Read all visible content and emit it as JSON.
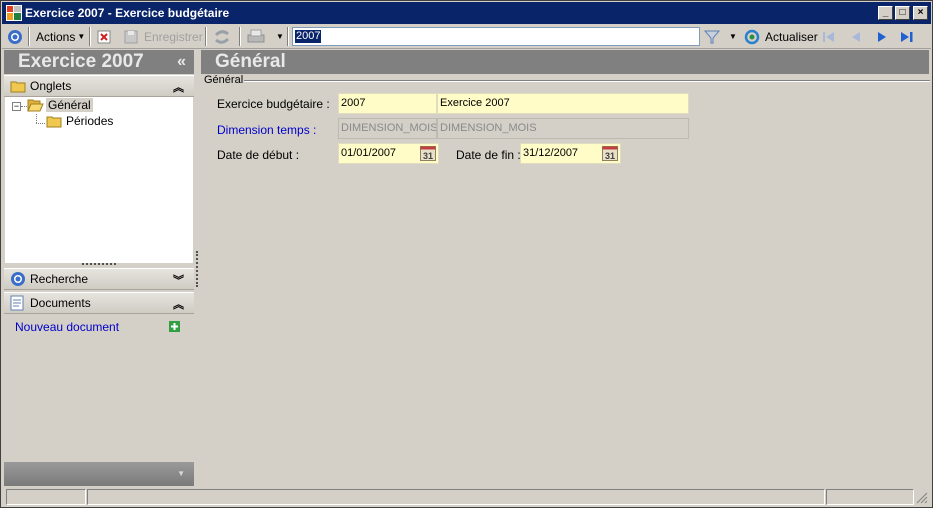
{
  "window": {
    "title": "Exercice 2007 -  Exercice budgétaire",
    "buttons": {
      "minimize": "_",
      "maximize": "□",
      "close": "×"
    }
  },
  "toolbar": {
    "actions_label": "Actions",
    "save_label": "Enregistrer",
    "search_value": "2007",
    "refresh_label": "Actualiser"
  },
  "left_panel": {
    "header": "Exercice 2007",
    "collapse_glyph": "«",
    "tabs_section": "Onglets",
    "tree": [
      {
        "label": "Général",
        "selected": true
      },
      {
        "label": "Périodes",
        "selected": false
      }
    ],
    "search_section": "Recherche",
    "documents_section": "Documents",
    "new_document": "Nouveau document"
  },
  "main": {
    "header": "Général",
    "group_title": "Général",
    "fields": {
      "exercise_label": "Exercice budgétaire :",
      "exercise_code": "2007",
      "exercise_name": "Exercice 2007",
      "dimension_label": "Dimension temps :",
      "dimension_code": "DIMENSION_MOIS",
      "dimension_name": "DIMENSION_MOIS",
      "start_label": "Date de début :",
      "start_value": "01/01/2007",
      "end_label": "Date de fin :",
      "end_value": "31/12/2007",
      "calendar_day": "31"
    }
  },
  "colors": {
    "titlebar": "#0a246a",
    "panel_header": "#808080",
    "required_field": "#fffcc8",
    "link": "#0000cc"
  }
}
